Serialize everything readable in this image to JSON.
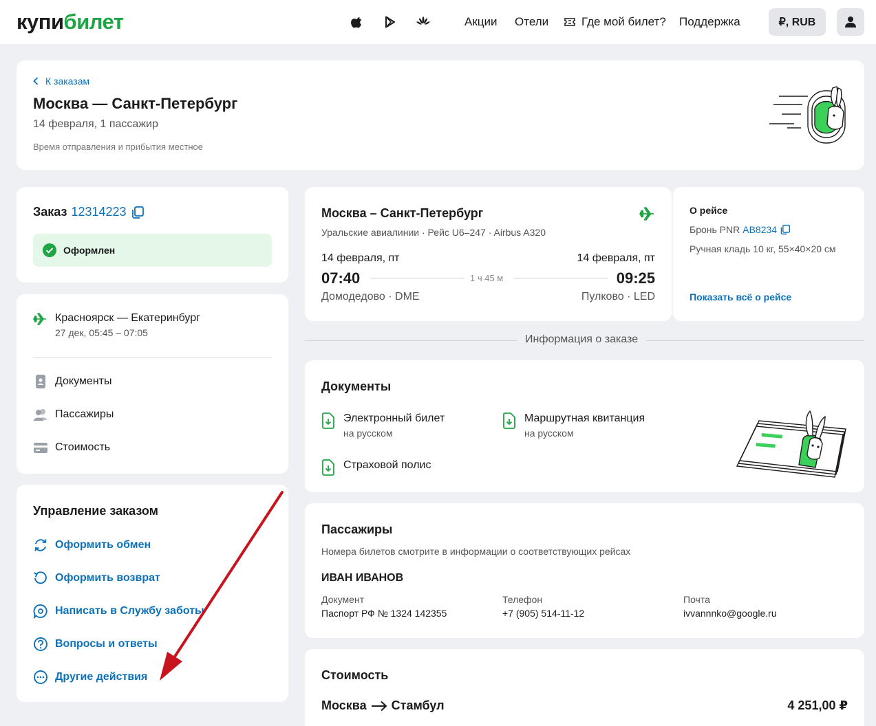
{
  "colors": {
    "accent": "#1fa446",
    "link": "#0d71b9",
    "status_bg": "#e4f7e8",
    "annotation_arrow": "#c8141e"
  },
  "header": {
    "logo_part1": "купи",
    "logo_part2": "билет",
    "store_icons": [
      "apple-icon",
      "google-play-icon",
      "huawei-icon"
    ],
    "nav": [
      "Акции",
      "Отели",
      "Где мой билет?",
      "Поддержка"
    ],
    "currency": "₽, RUB"
  },
  "trip": {
    "back_label": "К заказам",
    "title": "Москва — Санкт-Петербург",
    "subtitle": "14 февраля, 1 пассажир",
    "note": "Время отправления и прибытия местное"
  },
  "order": {
    "label": "Заказ",
    "number": "12314223",
    "status": "Оформлен"
  },
  "sidebar": {
    "route_title": "Красноярск — Екатеринбург",
    "route_time": "27 дек, 05:45 – 07:05",
    "items": [
      {
        "label": "Документы",
        "icon": "passport-icon"
      },
      {
        "label": "Пассажиры",
        "icon": "users-icon"
      },
      {
        "label": "Стоимость",
        "icon": "card-icon"
      }
    ]
  },
  "manage": {
    "title": "Управление заказом",
    "items": [
      {
        "label": "Оформить обмен",
        "icon": "exchange-icon"
      },
      {
        "label": "Оформить возврат",
        "icon": "refund-icon"
      },
      {
        "label": "Написать в Службу заботы",
        "icon": "chat-icon"
      },
      {
        "label": "Вопросы и ответы",
        "icon": "question-icon"
      },
      {
        "label": "Другие действия",
        "icon": "more-icon"
      }
    ]
  },
  "flight": {
    "title": "Москва – Санкт-Петербург",
    "subtitle": "Уральские авиалинии · Рейс U6–247 · Airbus A320",
    "dep_date": "14 февраля, пт",
    "dep_time": "07:40",
    "dep_airport": "Домодедово · DME",
    "duration": "1 ч 45 м",
    "arr_date": "14 февраля, пт",
    "arr_time": "09:25",
    "arr_airport": "Пулково · LED"
  },
  "about": {
    "title": "О рейсе",
    "pnr_label": "Бронь PNR",
    "pnr": "AB8234",
    "baggage": "Ручная кладь 10 кг, 55×40×20 см",
    "show_all": "Показать всё о рейсе"
  },
  "info_label": "Информация о заказе",
  "documents": {
    "title": "Документы",
    "items": [
      {
        "name": "Электронный билет",
        "lang": "на русском"
      },
      {
        "name": "Маршрутная квитанция",
        "lang": "на русском"
      },
      {
        "name": "Страховой полис",
        "lang": ""
      }
    ]
  },
  "passengers": {
    "title": "Пассажиры",
    "note": "Номера билетов смотрите в информации о соответствующих рейсах",
    "name": "ИВАН ИВАНОВ",
    "fields": [
      {
        "label": "Документ",
        "value": "Паспорт РФ № 1324 142355"
      },
      {
        "label": "Телефон",
        "value": "+7 (905) 514-11-12"
      },
      {
        "label": "Почта",
        "value": "ivvannnko@google.ru"
      }
    ]
  },
  "cost": {
    "title": "Стоимость",
    "route_from": "Москва",
    "route_to": "Стамбул",
    "total": "4 251,00 ₽"
  }
}
